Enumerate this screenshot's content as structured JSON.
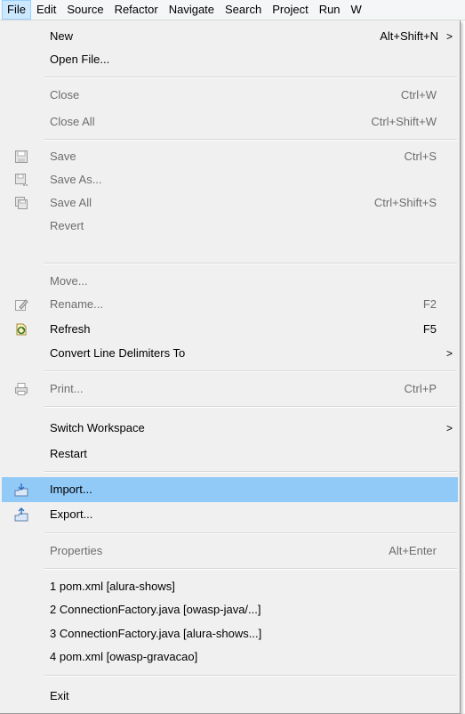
{
  "menubar": {
    "items": [
      "File",
      "Edit",
      "Source",
      "Refactor",
      "Navigate",
      "Search",
      "Project",
      "Run",
      "W"
    ]
  },
  "file_menu": {
    "new": {
      "label": "New",
      "accel": "Alt+Shift+N",
      "submenu_glyph": ">"
    },
    "open_file": {
      "label": "Open File..."
    },
    "close": {
      "label": "Close",
      "accel": "Ctrl+W"
    },
    "close_all": {
      "label": "Close All",
      "accel": "Ctrl+Shift+W"
    },
    "save": {
      "label": "Save",
      "accel": "Ctrl+S"
    },
    "save_as": {
      "label": "Save As..."
    },
    "save_all": {
      "label": "Save All",
      "accel": "Ctrl+Shift+S"
    },
    "revert": {
      "label": "Revert"
    },
    "move": {
      "label": "Move..."
    },
    "rename": {
      "label": "Rename...",
      "accel": "F2"
    },
    "refresh": {
      "label": "Refresh",
      "accel": "F5"
    },
    "convert": {
      "label": "Convert Line Delimiters To",
      "submenu_glyph": ">"
    },
    "print": {
      "label": "Print...",
      "accel": "Ctrl+P"
    },
    "switch_workspace": {
      "label": "Switch Workspace",
      "submenu_glyph": ">"
    },
    "restart": {
      "label": "Restart"
    },
    "import": {
      "label": "Import..."
    },
    "export": {
      "label": "Export..."
    },
    "properties": {
      "label": "Properties",
      "accel": "Alt+Enter"
    },
    "recent": [
      "1 pom.xml  [alura-shows]",
      "2 ConnectionFactory.java  [owasp-java/...]",
      "3 ConnectionFactory.java  [alura-shows...]",
      "4 pom.xml  [owasp-gravacao]"
    ],
    "exit": {
      "label": "Exit"
    }
  },
  "colors": {
    "highlight": "#91c9f7",
    "menu_bg": "#f0f0f0",
    "disabled_text": "#6d6d6d",
    "active_menu": "#cce8ff"
  }
}
